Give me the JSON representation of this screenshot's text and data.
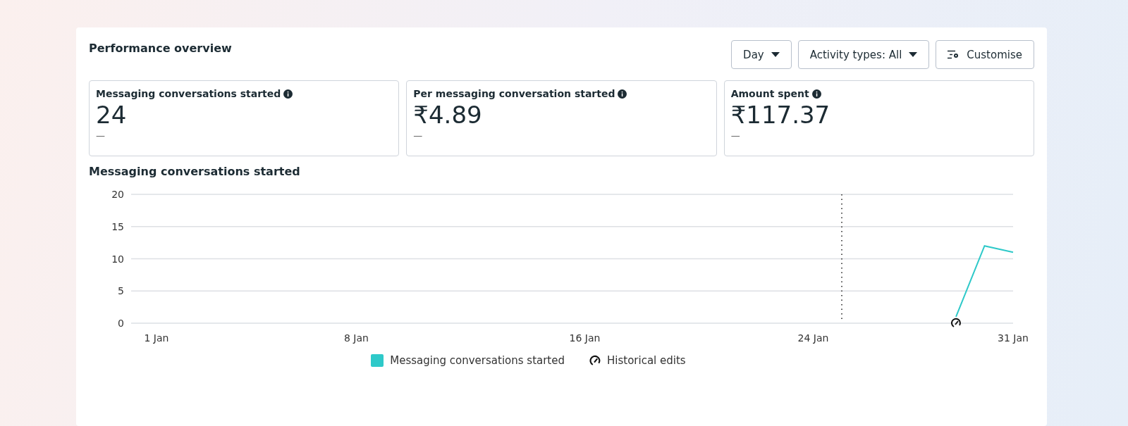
{
  "title": "Performance overview",
  "controls": [
    {
      "kind": "dropdown",
      "label": "Day"
    },
    {
      "kind": "dropdown",
      "label": "Activity types: All"
    },
    {
      "kind": "customise",
      "label": "Customise"
    }
  ],
  "metrics": [
    {
      "label": "Messaging conversations started",
      "value": "24",
      "change": "—"
    },
    {
      "label": "Per messaging conversation started",
      "value": "₹4.89",
      "change": "—"
    },
    {
      "label": "Amount spent",
      "value": "₹117.37",
      "change": "—"
    }
  ],
  "chart": {
    "title": "Messaging conversations started",
    "chart_data": {
      "type": "line",
      "categories": [
        "1 Jan",
        null,
        null,
        null,
        null,
        null,
        null,
        "8 Jan",
        null,
        null,
        null,
        null,
        null,
        null,
        null,
        "16 Jan",
        null,
        null,
        null,
        null,
        null,
        null,
        null,
        "24 Jan",
        null,
        null,
        null,
        null,
        null,
        null,
        "31 Jan"
      ],
      "series": [
        {
          "name": "Messaging conversations started",
          "color": "#2ec9c9",
          "values": [
            null,
            null,
            null,
            null,
            null,
            null,
            null,
            null,
            null,
            null,
            null,
            null,
            null,
            null,
            null,
            null,
            null,
            null,
            null,
            null,
            null,
            null,
            null,
            null,
            null,
            null,
            null,
            null,
            1,
            12,
            11
          ]
        }
      ],
      "ylim": [
        0,
        20
      ],
      "yticks": [
        0,
        5,
        10,
        15,
        20
      ],
      "grid": true
    },
    "legend": [
      {
        "kind": "series"
      },
      {
        "kind": "edits",
        "label": "Historical edits"
      }
    ]
  }
}
